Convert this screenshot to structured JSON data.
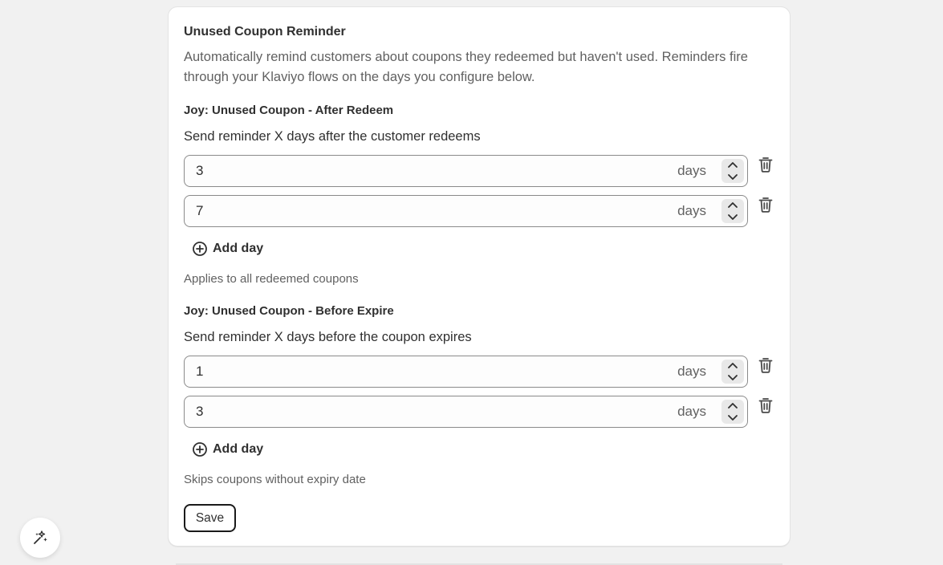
{
  "card": {
    "title": "Unused Coupon Reminder",
    "description": "Automatically remind customers about coupons they redeemed but haven't used. Reminders fire through your Klaviyo flows on the days you configure below."
  },
  "after_redeem": {
    "title": "Joy: Unused Coupon - After Redeem",
    "label": "Send reminder X days after the customer redeems",
    "fields": [
      {
        "value": "3",
        "suffix": "days"
      },
      {
        "value": "7",
        "suffix": "days"
      }
    ],
    "add_label": "Add day",
    "help": "Applies to all redeemed coupons"
  },
  "before_expire": {
    "title": "Joy: Unused Coupon - Before Expire",
    "label": "Send reminder X days before the coupon expires",
    "fields": [
      {
        "value": "1",
        "suffix": "days"
      },
      {
        "value": "3",
        "suffix": "days"
      }
    ],
    "add_label": "Add day",
    "help": "Skips coupons without expiry date"
  },
  "save_label": "Save",
  "icons": {
    "trash": "trash-icon",
    "plus_circle": "plus-circle-icon",
    "chevron_up": "chevron-up-icon",
    "chevron_down": "chevron-down-icon",
    "magic": "magic-sparkle-icon"
  }
}
